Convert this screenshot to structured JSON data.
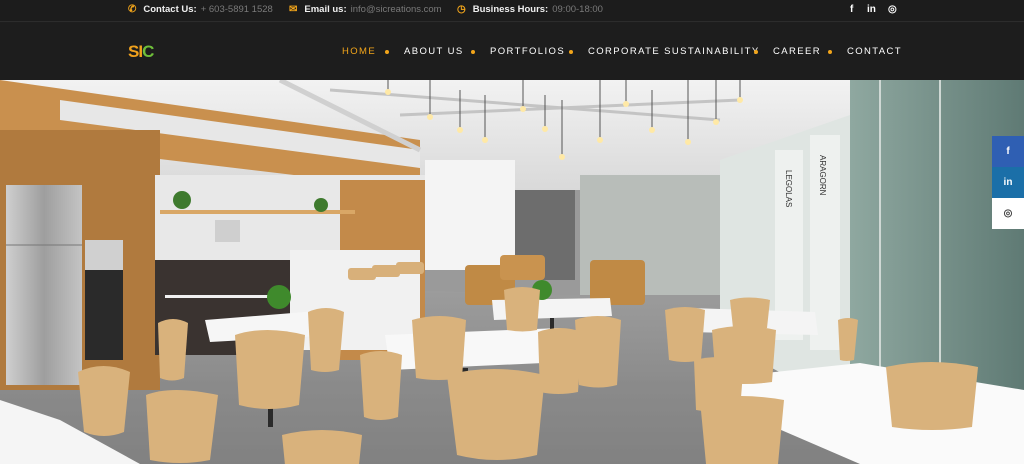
{
  "topbar": {
    "contact_label": "Contact Us:",
    "contact_value": "+ 603-5891 1528",
    "email_label": "Email us:",
    "email_value": "info@sicreations.com",
    "hours_label": "Business Hours:",
    "hours_value": "09:00-18:00",
    "social": [
      "f",
      "in",
      "◎"
    ]
  },
  "logo": {
    "s": "S",
    "i": "I",
    "c": "C"
  },
  "nav": {
    "items": [
      "HOME",
      "ABOUT US",
      "PORTFOLIOS",
      "CORPORATE SUSTAINABILITY",
      "CAREER",
      "CONTACT"
    ],
    "active": "HOME"
  },
  "hero": {
    "door_labels": [
      "LEGOLAS",
      "ARAGORN"
    ]
  },
  "side_social": [
    "f",
    "in",
    "◎"
  ],
  "icons": {
    "phone": "phone-icon",
    "email": "envelope-icon",
    "clock": "clock-icon"
  },
  "colors": {
    "accent": "#f2a51a",
    "logo_green": "#6fbf3a",
    "dark_bar": "#1d1d1d",
    "facebook_blue": "#2f5fb3",
    "linkedin_blue": "#1b6fa8"
  }
}
